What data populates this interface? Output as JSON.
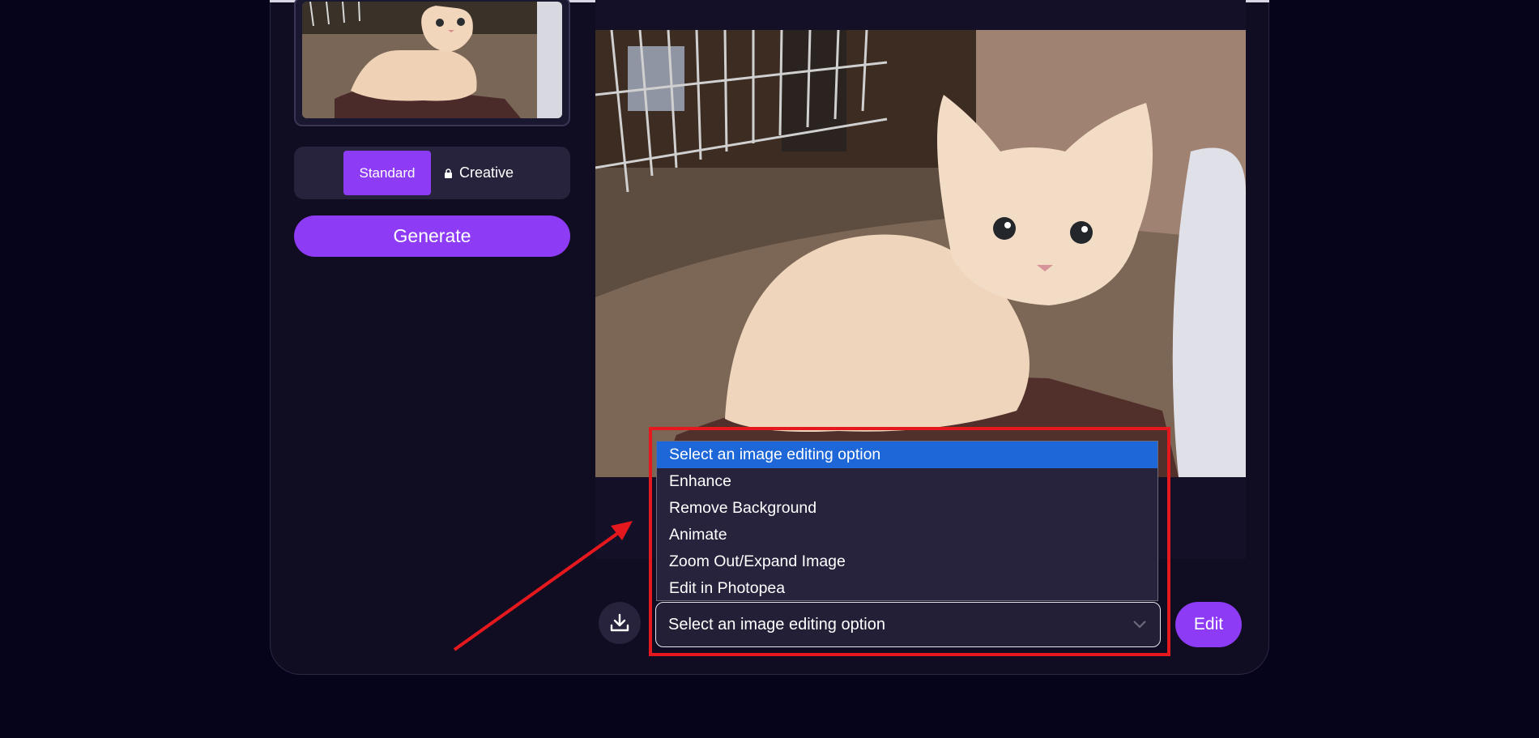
{
  "mode_toggle": {
    "standard_label": "Standard",
    "creative_label": "Creative",
    "selected": "Standard"
  },
  "generate": {
    "label": "Generate"
  },
  "editing": {
    "select_value": "Select an image editing option",
    "options": [
      "Select an image editing option",
      "Enhance",
      "Remove Background",
      "Animate",
      "Zoom Out/Expand Image",
      "Edit in Photopea"
    ],
    "selected_index": 0,
    "edit_label": "Edit"
  },
  "icons": {
    "download": "download-icon",
    "lock": "lock-icon",
    "chevron": "chevron-down-icon"
  },
  "colors": {
    "accent": "#8e3bf5",
    "background": "#05041a",
    "card": "#100d22",
    "option_highlight": "#1d67d8",
    "annotation": "#e5191d"
  }
}
